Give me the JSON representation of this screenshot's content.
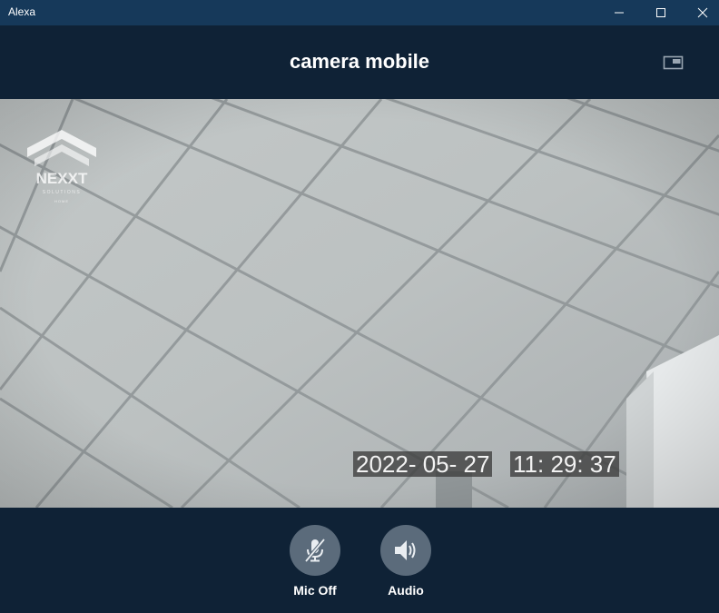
{
  "window": {
    "title": "Alexa",
    "controls": [
      "minimize",
      "maximize",
      "close"
    ]
  },
  "header": {
    "title": "camera mobile",
    "pip_icon": "picture-in-picture-icon"
  },
  "video": {
    "date": "2022- 05- 27",
    "time": "11: 29: 37",
    "logo": {
      "brand": "NEXXT",
      "sub": "SOLUTIONS",
      "sub2": "HOME"
    }
  },
  "controls": {
    "mic": {
      "label": "Mic Off",
      "icon": "mic-off-icon"
    },
    "audio": {
      "label": "Audio",
      "icon": "speaker-icon"
    }
  },
  "colors": {
    "titlebar": "#16395a",
    "background": "#0f2236",
    "button_circle": "#5b6b7b"
  }
}
